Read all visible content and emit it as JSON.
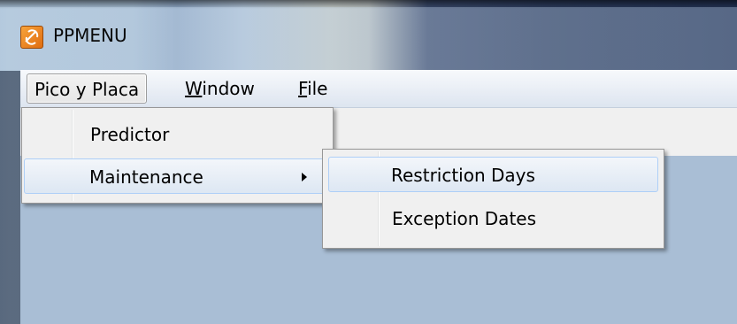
{
  "window": {
    "title": "PPMENU",
    "icon": "app-logo-icon"
  },
  "menubar": {
    "items": [
      {
        "label": "Pico y Placa",
        "state": "open"
      },
      {
        "label_prefix": "",
        "label_underlined": "W",
        "label_rest": "indow"
      },
      {
        "label_prefix": "",
        "label_underlined": "F",
        "label_rest": "ile"
      }
    ]
  },
  "pico_menu": {
    "items": [
      {
        "label": "Predictor"
      },
      {
        "label": "Maintenance",
        "submenu": true,
        "icon": "submenu-arrow-icon"
      }
    ]
  },
  "maintenance_menu": {
    "items": [
      {
        "label": "Restriction Days"
      },
      {
        "label": "Exception Dates"
      }
    ]
  },
  "colors": {
    "client_background": "#a9bed5",
    "menu_background": "#f0f0f0",
    "highlight_border": "#aecff7"
  }
}
